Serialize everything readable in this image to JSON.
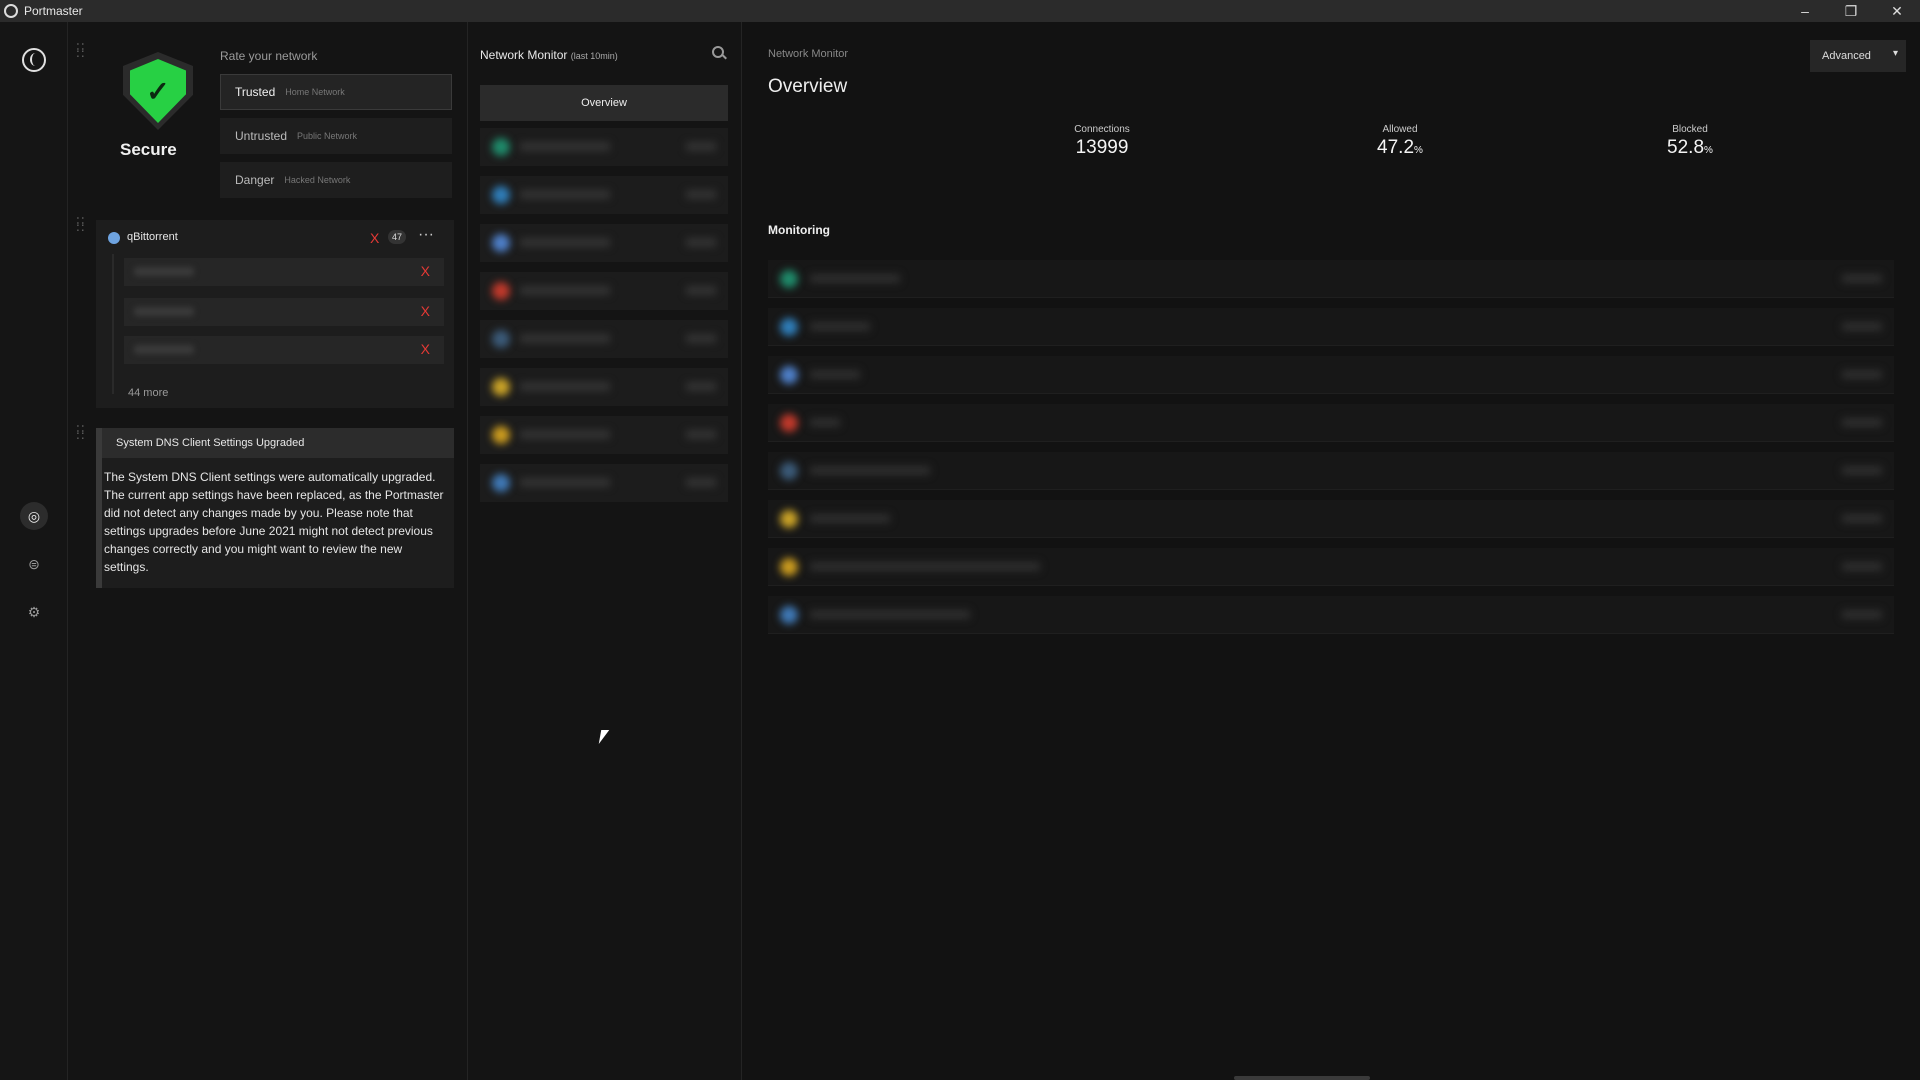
{
  "window": {
    "title": "Portmaster",
    "controls": {
      "minimize": "–",
      "restore": "❐",
      "close": "✕"
    }
  },
  "rail": {
    "icons": [
      "portmaster-logo-icon",
      "monitor-icon",
      "support-icon",
      "settings-icon"
    ],
    "glyphs": {
      "monitor": "◎",
      "support": "⊜",
      "settings": "⚙"
    }
  },
  "security": {
    "status": "Secure",
    "check_glyph": "✓",
    "rate_title": "Rate your network",
    "options": [
      {
        "name": "Trusted",
        "sub": "Home Network",
        "selected": true
      },
      {
        "name": "Untrusted",
        "sub": "Public Network",
        "selected": false
      },
      {
        "name": "Danger",
        "sub": "Hacked Network",
        "selected": false
      }
    ],
    "accent": "#27d044"
  },
  "blocked_app": {
    "name": "qBittorrent",
    "x_label": "X",
    "count": "47",
    "more_glyph": "···",
    "rows": [
      {
        "x": "X"
      },
      {
        "x": "X"
      },
      {
        "x": "X"
      }
    ],
    "more": "44 more"
  },
  "notice": {
    "title": "System DNS Client Settings Upgraded",
    "body": "The System DNS Client settings were automatically upgraded. The current app settings have been replaced, as the Portmaster did not detect any changes made by you. Please note that settings upgrades before June 2021 might not detect previous changes correctly and you might want to review the new settings."
  },
  "monitor": {
    "title": "Network Monitor",
    "title_small": "(last 10min)",
    "overview_button": "Overview",
    "rows": [
      {
        "color": "#1f8a6a"
      },
      {
        "color": "#2f7db8"
      },
      {
        "color": "#4e7fc8"
      },
      {
        "color": "#c0392b"
      },
      {
        "color": "#3b5a78"
      },
      {
        "color": "#c9a227"
      },
      {
        "color": "#c99a1f"
      },
      {
        "color": "#3f78b5"
      }
    ]
  },
  "main": {
    "breadcrumb": "Network Monitor",
    "title": "Overview",
    "advanced_button": "Advanced",
    "chevron": "▾",
    "stats": {
      "connections_label": "Connections",
      "connections_value": "13999",
      "allowed_label": "Allowed",
      "allowed_value": "47.2",
      "blocked_label": "Blocked",
      "blocked_value": "52.8",
      "unit": "%"
    },
    "monitoring_title": "Monitoring",
    "rows": [
      {
        "color": "#1f8a6a"
      },
      {
        "color": "#2f7db8"
      },
      {
        "color": "#4e7fc8"
      },
      {
        "color": "#c0392b"
      },
      {
        "color": "#3b5a78"
      },
      {
        "color": "#c9a227"
      },
      {
        "color": "#c99a1f"
      },
      {
        "color": "#3f78b5"
      }
    ]
  }
}
